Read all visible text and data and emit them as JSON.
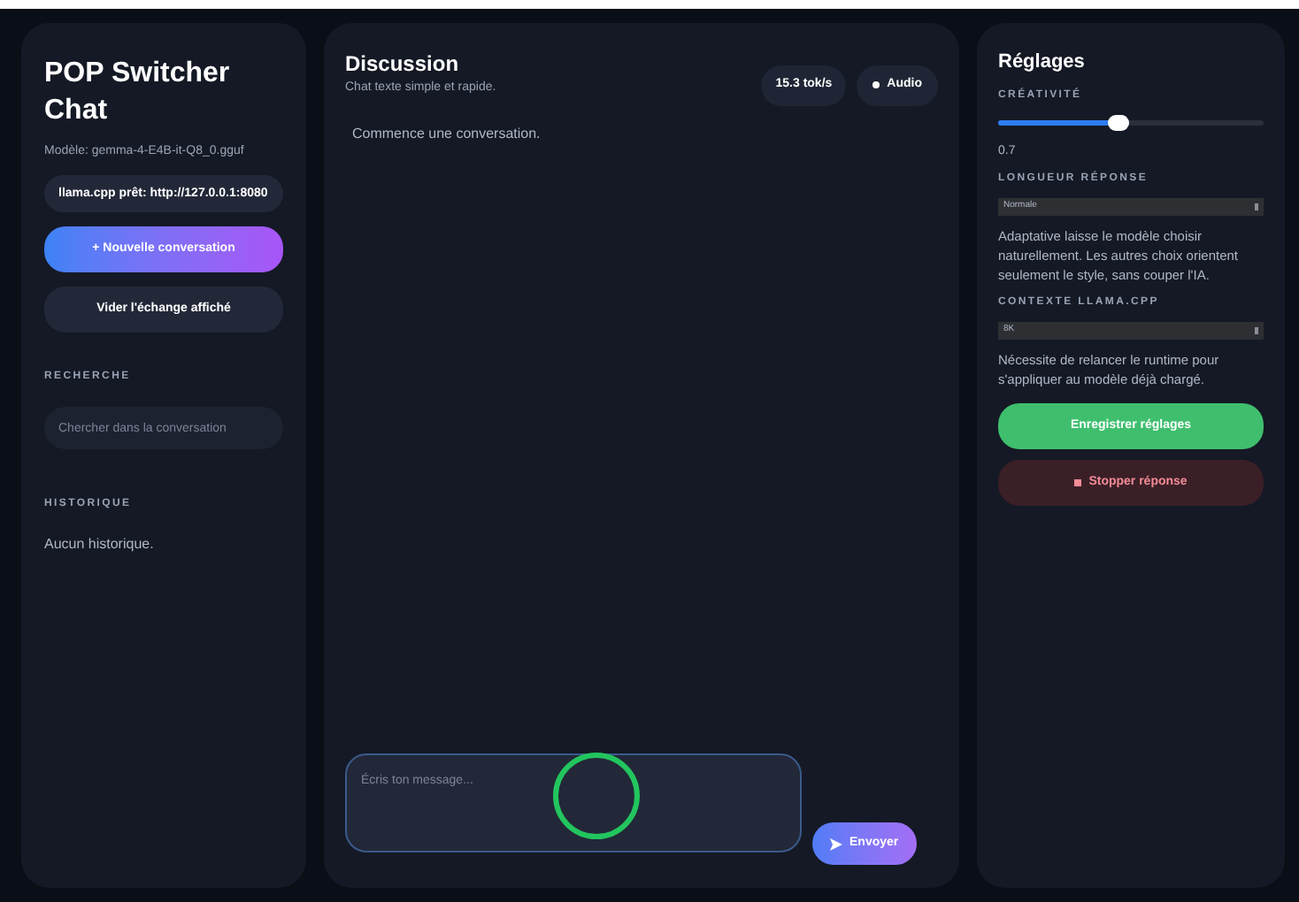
{
  "sidebar": {
    "title": "POP Switcher Chat",
    "model": "Modèle: gemma-4-E4B-it-Q8_0.gguf",
    "status": "llama.cpp prêt: http://127.0.0.1:8080",
    "new_button": "+ Nouvelle conversation",
    "clear_button": "Vider l'échange affiché",
    "search_label": "RECHERCHE",
    "search": {
      "placeholder": "Chercher dans la conversation"
    },
    "history_label": "HISTORIQUE",
    "history_empty": "Aucun historique."
  },
  "chat": {
    "title": "Discussion",
    "subtitle": "Chat texte simple et rapide.",
    "speed": "15.3 tok/s",
    "audio_button": "Audio",
    "empty": "Commence une conversation.",
    "input": {
      "placeholder": "Écris ton message..."
    },
    "send_button": "Envoyer"
  },
  "settings": {
    "title": "Réglages",
    "creativity_label": "CRÉATIVITÉ",
    "creativity": {
      "level": 0.45
    },
    "creativity_value": "0.7",
    "length_label": "LONGUEUR RÉPONSE",
    "length_value": "Normale",
    "length_help": "Adaptative laisse le modèle choisir naturellement. Les autres choix orientent seulement le style, sans couper l'IA.",
    "context_label": "CONTEXTE LLAMA.CPP",
    "context_value": "8K",
    "context_help": "Nécessite de relancer le runtime pour s'appliquer au modèle déjà chargé.",
    "save_button": "Enregistrer réglages",
    "stop_button": "Stopper réponse"
  }
}
